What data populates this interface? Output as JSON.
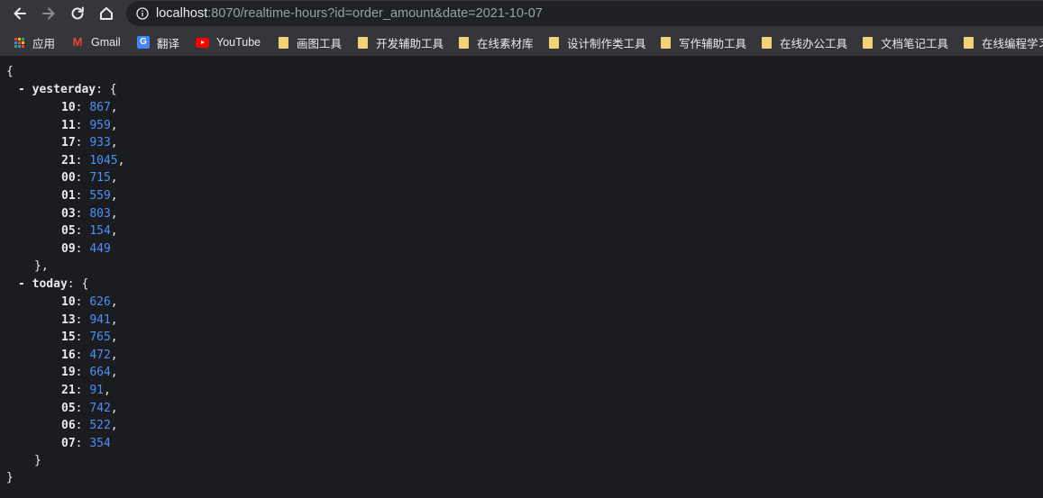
{
  "browser": {
    "url_host": "localhost",
    "url_rest": ":8070/realtime-hours?id=order_amount&date=2021-10-07"
  },
  "bookmarks": [
    {
      "label": "应用",
      "icon": "apps-grid-icon"
    },
    {
      "label": "Gmail",
      "icon": "gmail-icon"
    },
    {
      "label": "翻译",
      "icon": "google-translate-icon"
    },
    {
      "label": "YouTube",
      "icon": "youtube-icon"
    },
    {
      "label": "画图工具",
      "icon": "folder-icon"
    },
    {
      "label": "开发辅助工具",
      "icon": "folder-icon"
    },
    {
      "label": "在线素材库",
      "icon": "folder-icon"
    },
    {
      "label": "设计制作类工具",
      "icon": "folder-icon"
    },
    {
      "label": "写作辅助工具",
      "icon": "folder-icon"
    },
    {
      "label": "在线办公工具",
      "icon": "folder-icon"
    },
    {
      "label": "文档笔记工具",
      "icon": "folder-icon"
    },
    {
      "label": "在线编程学习",
      "icon": "folder-icon"
    }
  ],
  "json": {
    "open_brace": "{",
    "close_brace": "}",
    "toggle": "-",
    "yesterday": {
      "key": "yesterday",
      "entries": [
        {
          "hour": "10",
          "value": "867"
        },
        {
          "hour": "11",
          "value": "959"
        },
        {
          "hour": "17",
          "value": "933"
        },
        {
          "hour": "21",
          "value": "1045"
        },
        {
          "hour": "00",
          "value": "715"
        },
        {
          "hour": "01",
          "value": "559"
        },
        {
          "hour": "03",
          "value": "803"
        },
        {
          "hour": "05",
          "value": "154"
        },
        {
          "hour": "09",
          "value": "449"
        }
      ]
    },
    "today": {
      "key": "today",
      "entries": [
        {
          "hour": "10",
          "value": "626"
        },
        {
          "hour": "13",
          "value": "941"
        },
        {
          "hour": "15",
          "value": "765"
        },
        {
          "hour": "16",
          "value": "472"
        },
        {
          "hour": "19",
          "value": "664"
        },
        {
          "hour": "21",
          "value": "91"
        },
        {
          "hour": "05",
          "value": "742"
        },
        {
          "hour": "06",
          "value": "522"
        },
        {
          "hour": "07",
          "value": "354"
        }
      ]
    }
  },
  "colors": {
    "background": "#1b1c1f",
    "chrome": "#35363a",
    "number": "#4d8ff7",
    "text": "#e8eaed"
  }
}
